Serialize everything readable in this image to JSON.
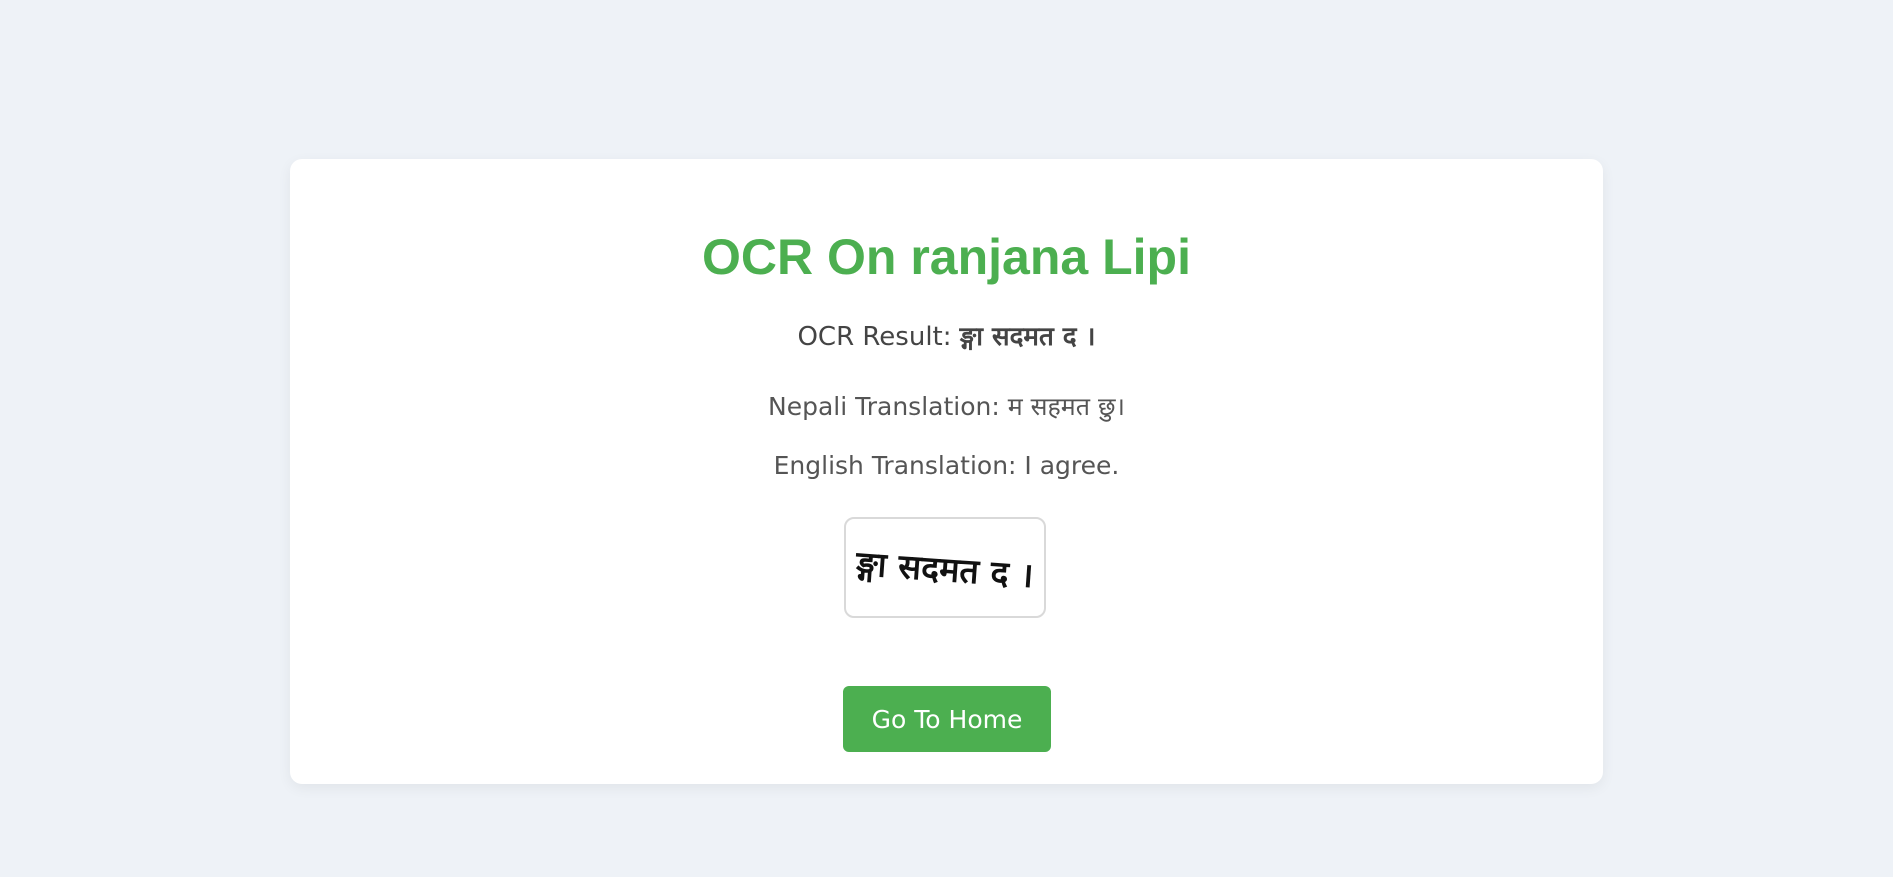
{
  "page": {
    "title": "OCR On ranjana Lipi",
    "ocr_result_label": "OCR Result:",
    "ocr_result_value": "ङ्गा सदमत द ।",
    "nepali_translation": "Nepali Translation: म सहमत छु।",
    "english_translation": "English Translation: I agree.",
    "script_image_text": "ङ्गा सदमत द ।",
    "home_button_label": "Go To Home"
  },
  "colors": {
    "accent": "#4caf50",
    "background": "#eef2f7",
    "card": "#ffffff"
  }
}
